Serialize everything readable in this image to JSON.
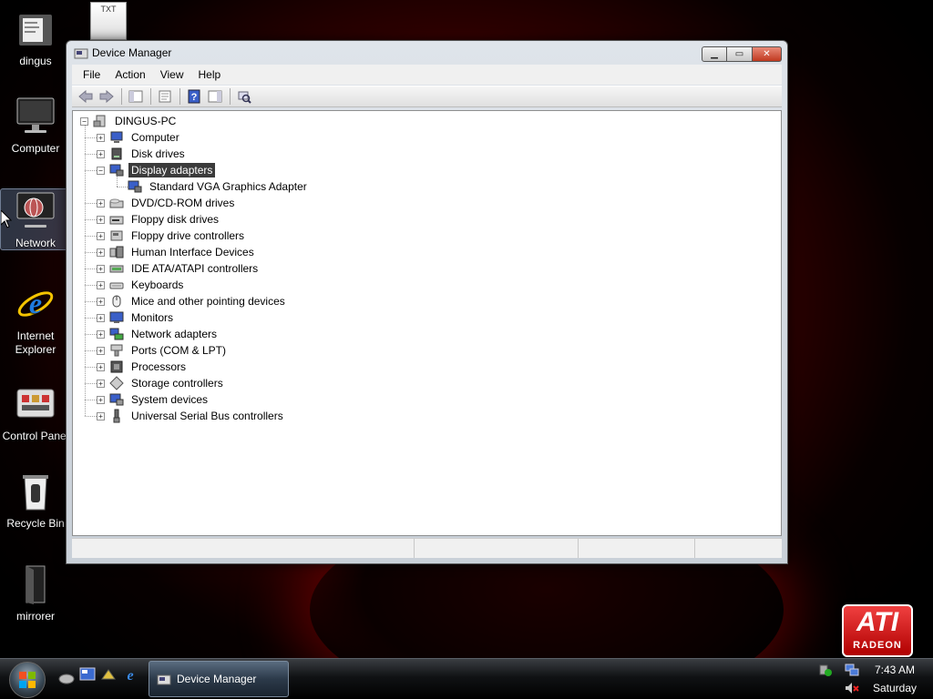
{
  "desktop": {
    "icons": [
      {
        "label": "dingus"
      },
      {
        "label": "Computer"
      },
      {
        "label": "Network"
      },
      {
        "label": "Internet Explorer"
      },
      {
        "label": "Control Panel"
      },
      {
        "label": "Recycle Bin"
      },
      {
        "label": "mirrorer"
      }
    ],
    "txt_file_label": "TXT"
  },
  "window": {
    "title": "Device Manager",
    "menu": [
      "File",
      "Action",
      "View",
      "Help"
    ],
    "tree": {
      "root": "DINGUS-PC",
      "categories": [
        {
          "label": "Computer",
          "expanded": false,
          "icon": "computer-icon"
        },
        {
          "label": "Disk drives",
          "expanded": false,
          "icon": "disk-drive-icon"
        },
        {
          "label": "Display adapters",
          "expanded": true,
          "selected": true,
          "icon": "display-adapter-icon",
          "children": [
            "Standard VGA Graphics Adapter"
          ]
        },
        {
          "label": "DVD/CD-ROM drives",
          "expanded": false,
          "icon": "dvd-drive-icon"
        },
        {
          "label": "Floppy disk drives",
          "expanded": false,
          "icon": "floppy-drive-icon"
        },
        {
          "label": "Floppy drive controllers",
          "expanded": false,
          "icon": "floppy-controller-icon"
        },
        {
          "label": "Human Interface Devices",
          "expanded": false,
          "icon": "hid-icon"
        },
        {
          "label": "IDE ATA/ATAPI controllers",
          "expanded": false,
          "icon": "ide-controller-icon"
        },
        {
          "label": "Keyboards",
          "expanded": false,
          "icon": "keyboard-icon"
        },
        {
          "label": "Mice and other pointing devices",
          "expanded": false,
          "icon": "mouse-icon"
        },
        {
          "label": "Monitors",
          "expanded": false,
          "icon": "monitor-icon"
        },
        {
          "label": "Network adapters",
          "expanded": false,
          "icon": "network-adapter-icon"
        },
        {
          "label": "Ports (COM & LPT)",
          "expanded": false,
          "icon": "port-icon"
        },
        {
          "label": "Processors",
          "expanded": false,
          "icon": "processor-icon"
        },
        {
          "label": "Storage controllers",
          "expanded": false,
          "icon": "storage-controller-icon"
        },
        {
          "label": "System devices",
          "expanded": false,
          "icon": "system-device-icon"
        },
        {
          "label": "Universal Serial Bus controllers",
          "expanded": false,
          "icon": "usb-icon"
        }
      ]
    }
  },
  "branding": {
    "ati": "ATI",
    "radeon": "RADEON"
  },
  "taskbar": {
    "task_label": "Device Manager",
    "time": "7:43 AM",
    "day": "Saturday"
  },
  "colors": {
    "selection": "#3b3b3b",
    "ati_red": "#d01818"
  }
}
